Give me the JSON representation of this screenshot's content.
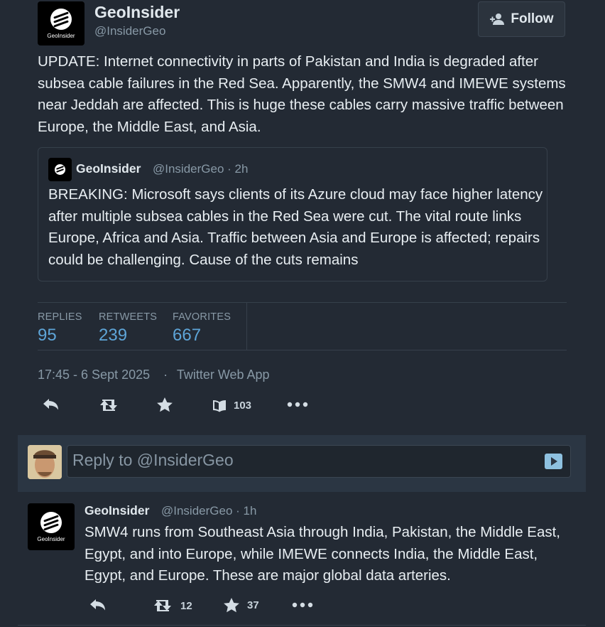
{
  "account": {
    "name": "GeoInsider",
    "handle": "@InsiderGeo",
    "avatar_brand": "GeoInsider"
  },
  "follow_label": "Follow",
  "tweet": {
    "text": "UPDATE: Internet connectivity in parts of Pakistan and India is degraded after subsea cable failures in the Red Sea. Apparently, the SMW4 and IMEWE systems near Jeddah are affected. This is huge these cables carry massive traffic between Europe, the Middle East, and Asia."
  },
  "quote": {
    "name": "GeoInsider",
    "meta": "@InsiderGeo · 2h",
    "text": "BREAKING: Microsoft says clients of its Azure cloud may face higher latency after multiple subsea cables in the Red Sea were cut. The vital route links Europe, Africa and Asia. Traffic between Asia and Europe is affected; repairs could be challenging. Cause of the cuts remains"
  },
  "stats": {
    "replies_label": "REPLIES",
    "replies": "95",
    "retweets_label": "RETWEETS",
    "retweets": "239",
    "favorites_label": "FAVORITES",
    "favorites": "667"
  },
  "timestamp": "17:45 - 6 Sept 2025",
  "source": "Twitter Web App",
  "actions": {
    "bookmark_count": "103"
  },
  "reply_box": {
    "placeholder": "Reply to @InsiderGeo"
  },
  "reply_tweet": {
    "name": "GeoInsider",
    "meta": "@InsiderGeo · 1h",
    "text": "SMW4 runs from Southeast Asia through India, Pakistan, the Middle East, Egypt, and into Europe, while IMEWE connects India, the Middle East, Egypt, and Europe. These are major global data arteries.",
    "retweet_count": "12",
    "favorite_count": "37"
  },
  "colors": {
    "background": "#232a34",
    "accent": "#5ea5d8",
    "muted": "#8899a6"
  }
}
